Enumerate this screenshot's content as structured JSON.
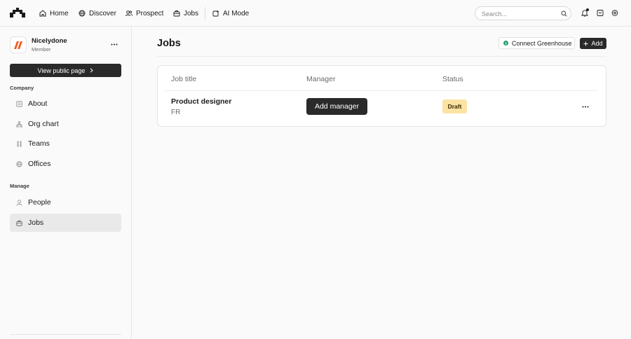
{
  "topbar": {
    "logo_icon": "brand-logo-icon",
    "nav": [
      {
        "label": "Home",
        "icon": "home-icon"
      },
      {
        "label": "Discover",
        "icon": "globe-icon"
      },
      {
        "label": "Prospect",
        "icon": "users-icon"
      },
      {
        "label": "Jobs",
        "icon": "briefcase-icon"
      },
      {
        "label": "AI Mode",
        "icon": "sparkle-icon"
      }
    ],
    "search_placeholder": "Search...",
    "icons": [
      "bell-icon",
      "messages-icon",
      "settings-icon"
    ]
  },
  "sidebar": {
    "org_name": "Nicelydone",
    "org_role": "Member",
    "view_public_label": "View public page",
    "sections": [
      {
        "label": "Company",
        "items": [
          {
            "label": "About",
            "icon": "about-icon"
          },
          {
            "label": "Org chart",
            "icon": "org-chart-icon"
          },
          {
            "label": "Teams",
            "icon": "teams-icon"
          },
          {
            "label": "Offices",
            "icon": "globe-icon"
          }
        ]
      },
      {
        "label": "Manage",
        "items": [
          {
            "label": "People",
            "icon": "person-icon"
          },
          {
            "label": "Jobs",
            "icon": "briefcase-icon",
            "active": true
          }
        ]
      }
    ]
  },
  "main": {
    "title": "Jobs",
    "connect_label": "Connect Greenhouse",
    "add_label": "Add",
    "table": {
      "columns": [
        "Job title",
        "Manager",
        "Status"
      ],
      "rows": [
        {
          "title": "Product designer",
          "location": "FR",
          "manager_action": "Add manager",
          "status": "Draft"
        }
      ]
    }
  },
  "colors": {
    "primary_dark": "#2a2a2a",
    "status_draft_bg": "#fbe3a3",
    "greenhouse_green": "#2e9e6b",
    "brand_orange": "#f25a1d"
  }
}
